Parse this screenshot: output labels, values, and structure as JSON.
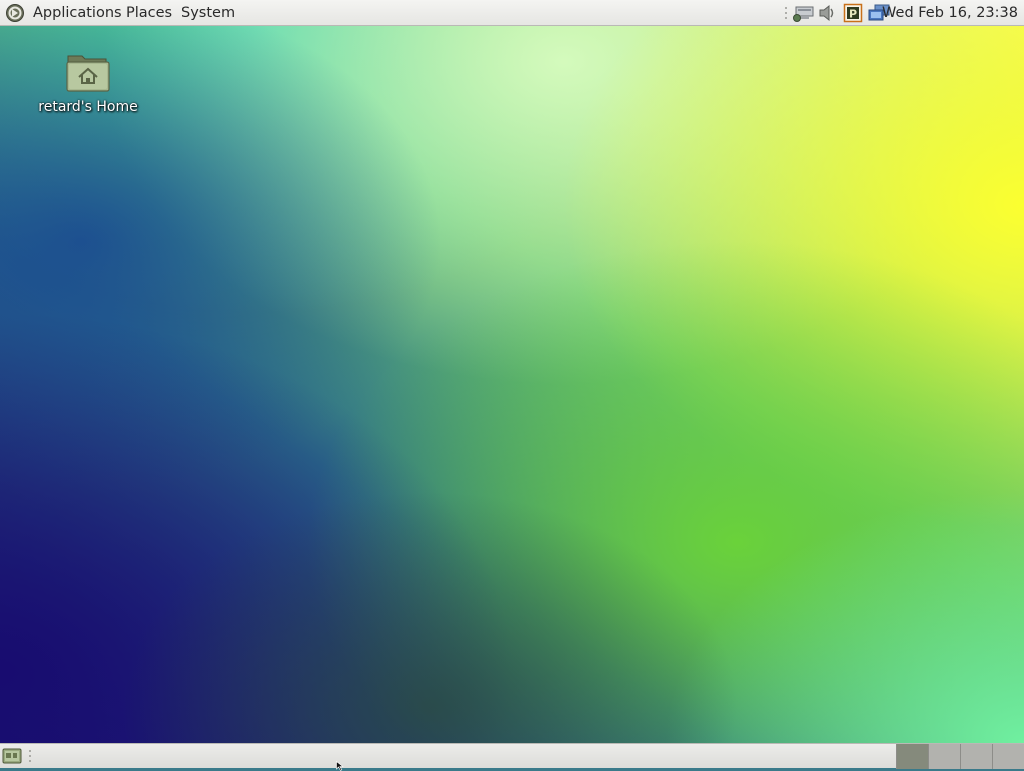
{
  "top_panel": {
    "menus": [
      {
        "label": "Applications"
      },
      {
        "label": "Places"
      },
      {
        "label": "System"
      }
    ],
    "tray": [
      "network-icon",
      "volume-icon",
      "p-applet-icon",
      "display-icon"
    ],
    "clock": "Wed Feb 16, 23:38"
  },
  "desktop": {
    "icons": [
      {
        "label": "retard's Home",
        "icon": "home-folder-icon"
      }
    ]
  },
  "bottom_panel": {
    "workspaces": 4,
    "active_workspace": 1
  },
  "colors": {
    "panel": "#e8e8e5",
    "background_blue": "#14106a",
    "background_green": "#6ad040",
    "background_yellow": "#ffff40",
    "background_teal": "#3cc8a8"
  }
}
